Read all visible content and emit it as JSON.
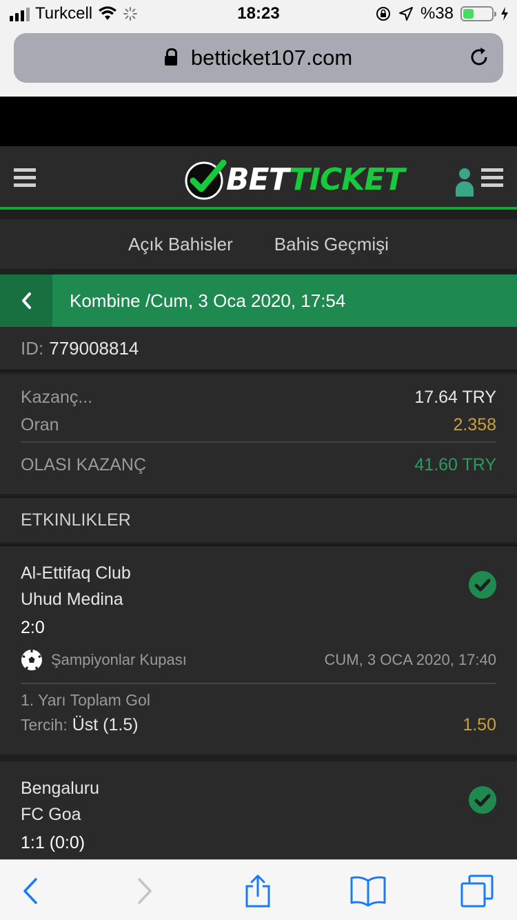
{
  "status": {
    "carrier": "Turkcell",
    "time": "18:23",
    "battery_pct": "%38",
    "battery_level": 0.38
  },
  "browser": {
    "url": "betticket107.com"
  },
  "site": {
    "logo_part1": "BET",
    "logo_part2": "TICKET",
    "colors": {
      "green": "#18c93b",
      "bar": "#1e8a4f",
      "odds": "#c8a13a",
      "win": "#2a9a63"
    }
  },
  "tabs": [
    "Açık Bahisler",
    "Bahis Geçmişi"
  ],
  "bet": {
    "title": "Kombine /Cum, 3 Oca 2020, 17:54",
    "id_label": "ID:",
    "id_value": "779008814",
    "stake_label": "Kazanç...",
    "stake_value": "17.64 TRY",
    "odds_label": "Oran",
    "odds_value": "2.358",
    "payout_label": "OLASI KAZANÇ",
    "payout_value": "41.60 TRY"
  },
  "events_heading": "ETKINLIKLER",
  "events": [
    {
      "home": "Al-Ettifaq Club",
      "away": "Uhud Medina",
      "score": "2:0",
      "league": "Şampiyonlar Kupası",
      "datetime": "CUM, 3 OCA 2020, 17:40",
      "market": "1. Yarı Toplam Gol",
      "pick_label": "Tercih:",
      "pick_value": "Üst (1.5)",
      "odds": "1.50",
      "status_icon": "check-circle-icon"
    },
    {
      "home": "Bengaluru",
      "away": "FC Goa",
      "score": "1:1 (0:0)",
      "status_icon": "check-circle-icon"
    }
  ]
}
